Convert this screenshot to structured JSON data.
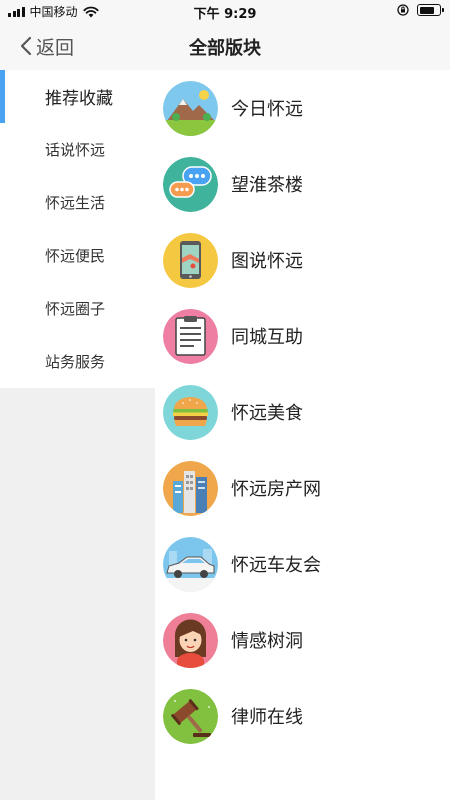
{
  "status_bar": {
    "carrier": "中国移动",
    "time": "下午 9:29"
  },
  "nav": {
    "back_label": "返回",
    "title": "全部版块"
  },
  "sidebar": {
    "items": [
      {
        "label": "推荐收藏",
        "active": true
      },
      {
        "label": "话说怀远",
        "active": false
      },
      {
        "label": "怀远生活",
        "active": false
      },
      {
        "label": "怀远便民",
        "active": false
      },
      {
        "label": "怀远圈子",
        "active": false
      },
      {
        "label": "站务服务",
        "active": false
      }
    ]
  },
  "boards": [
    {
      "label": "今日怀远",
      "icon": "mountain-sun-icon",
      "color": "#7dc8ec"
    },
    {
      "label": "望淮茶楼",
      "icon": "chat-bubbles-icon",
      "color": "#3fb39b"
    },
    {
      "label": "图说怀远",
      "icon": "phone-map-icon",
      "color": "#f5c842"
    },
    {
      "label": "同城互助",
      "icon": "clipboard-icon",
      "color": "#ee7fa3"
    },
    {
      "label": "怀远美食",
      "icon": "burger-icon",
      "color": "#7ed6d8"
    },
    {
      "label": "怀远房产网",
      "icon": "buildings-icon",
      "color": "#f0a64a"
    },
    {
      "label": "怀远车友会",
      "icon": "car-icon",
      "color": "#7cc6ee"
    },
    {
      "label": "情感树洞",
      "icon": "girl-avatar-icon",
      "color": "#ee7f96"
    },
    {
      "label": "律师在线",
      "icon": "gavel-icon",
      "color": "#82c040"
    }
  ],
  "colors": {
    "accent": "#4aa3f2",
    "sidebar_bg": "#f0f0f0",
    "nav_bg": "#f7f7f7"
  }
}
